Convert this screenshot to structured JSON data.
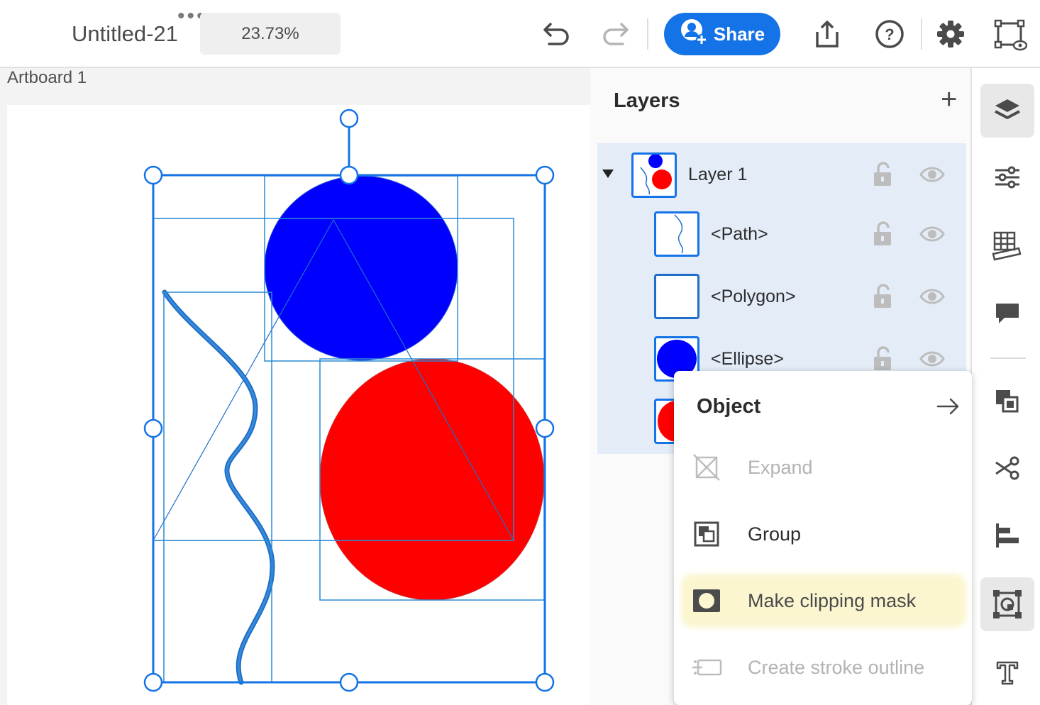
{
  "document": {
    "title": "Untitled-21",
    "zoom": "23.73%"
  },
  "toolbar": {
    "share_label": "Share"
  },
  "canvas": {
    "artboard_label": "Artboard 1"
  },
  "layers_panel": {
    "title": "Layers",
    "items": [
      {
        "name": "Layer 1",
        "level": 0,
        "expanded": true
      },
      {
        "name": "<Path>",
        "level": 1
      },
      {
        "name": "<Polygon>",
        "level": 1
      },
      {
        "name": "<Ellipse>",
        "level": 1
      },
      {
        "name": "",
        "level": 1
      }
    ]
  },
  "context_menu": {
    "title": "Object",
    "items": [
      {
        "label": "Expand",
        "enabled": false
      },
      {
        "label": "Group",
        "enabled": true
      },
      {
        "label": "Make clipping mask",
        "enabled": true,
        "highlighted": true
      },
      {
        "label": "Create stroke outline",
        "enabled": false
      }
    ]
  },
  "colors": {
    "accent": "#1473e6",
    "ellipse_blue": "#0000ff",
    "ellipse_red": "#ff0000",
    "highlight": "#fbf6d0"
  },
  "icons": [
    "undo-icon",
    "redo-icon",
    "share-user-icon",
    "export-icon",
    "help-icon",
    "settings-icon",
    "prototype-icon",
    "layers-icon",
    "properties-icon",
    "grid-ruler-icon",
    "comment-icon",
    "arrange-icon",
    "scissors-icon",
    "align-icon",
    "object-icon",
    "text-icon"
  ]
}
